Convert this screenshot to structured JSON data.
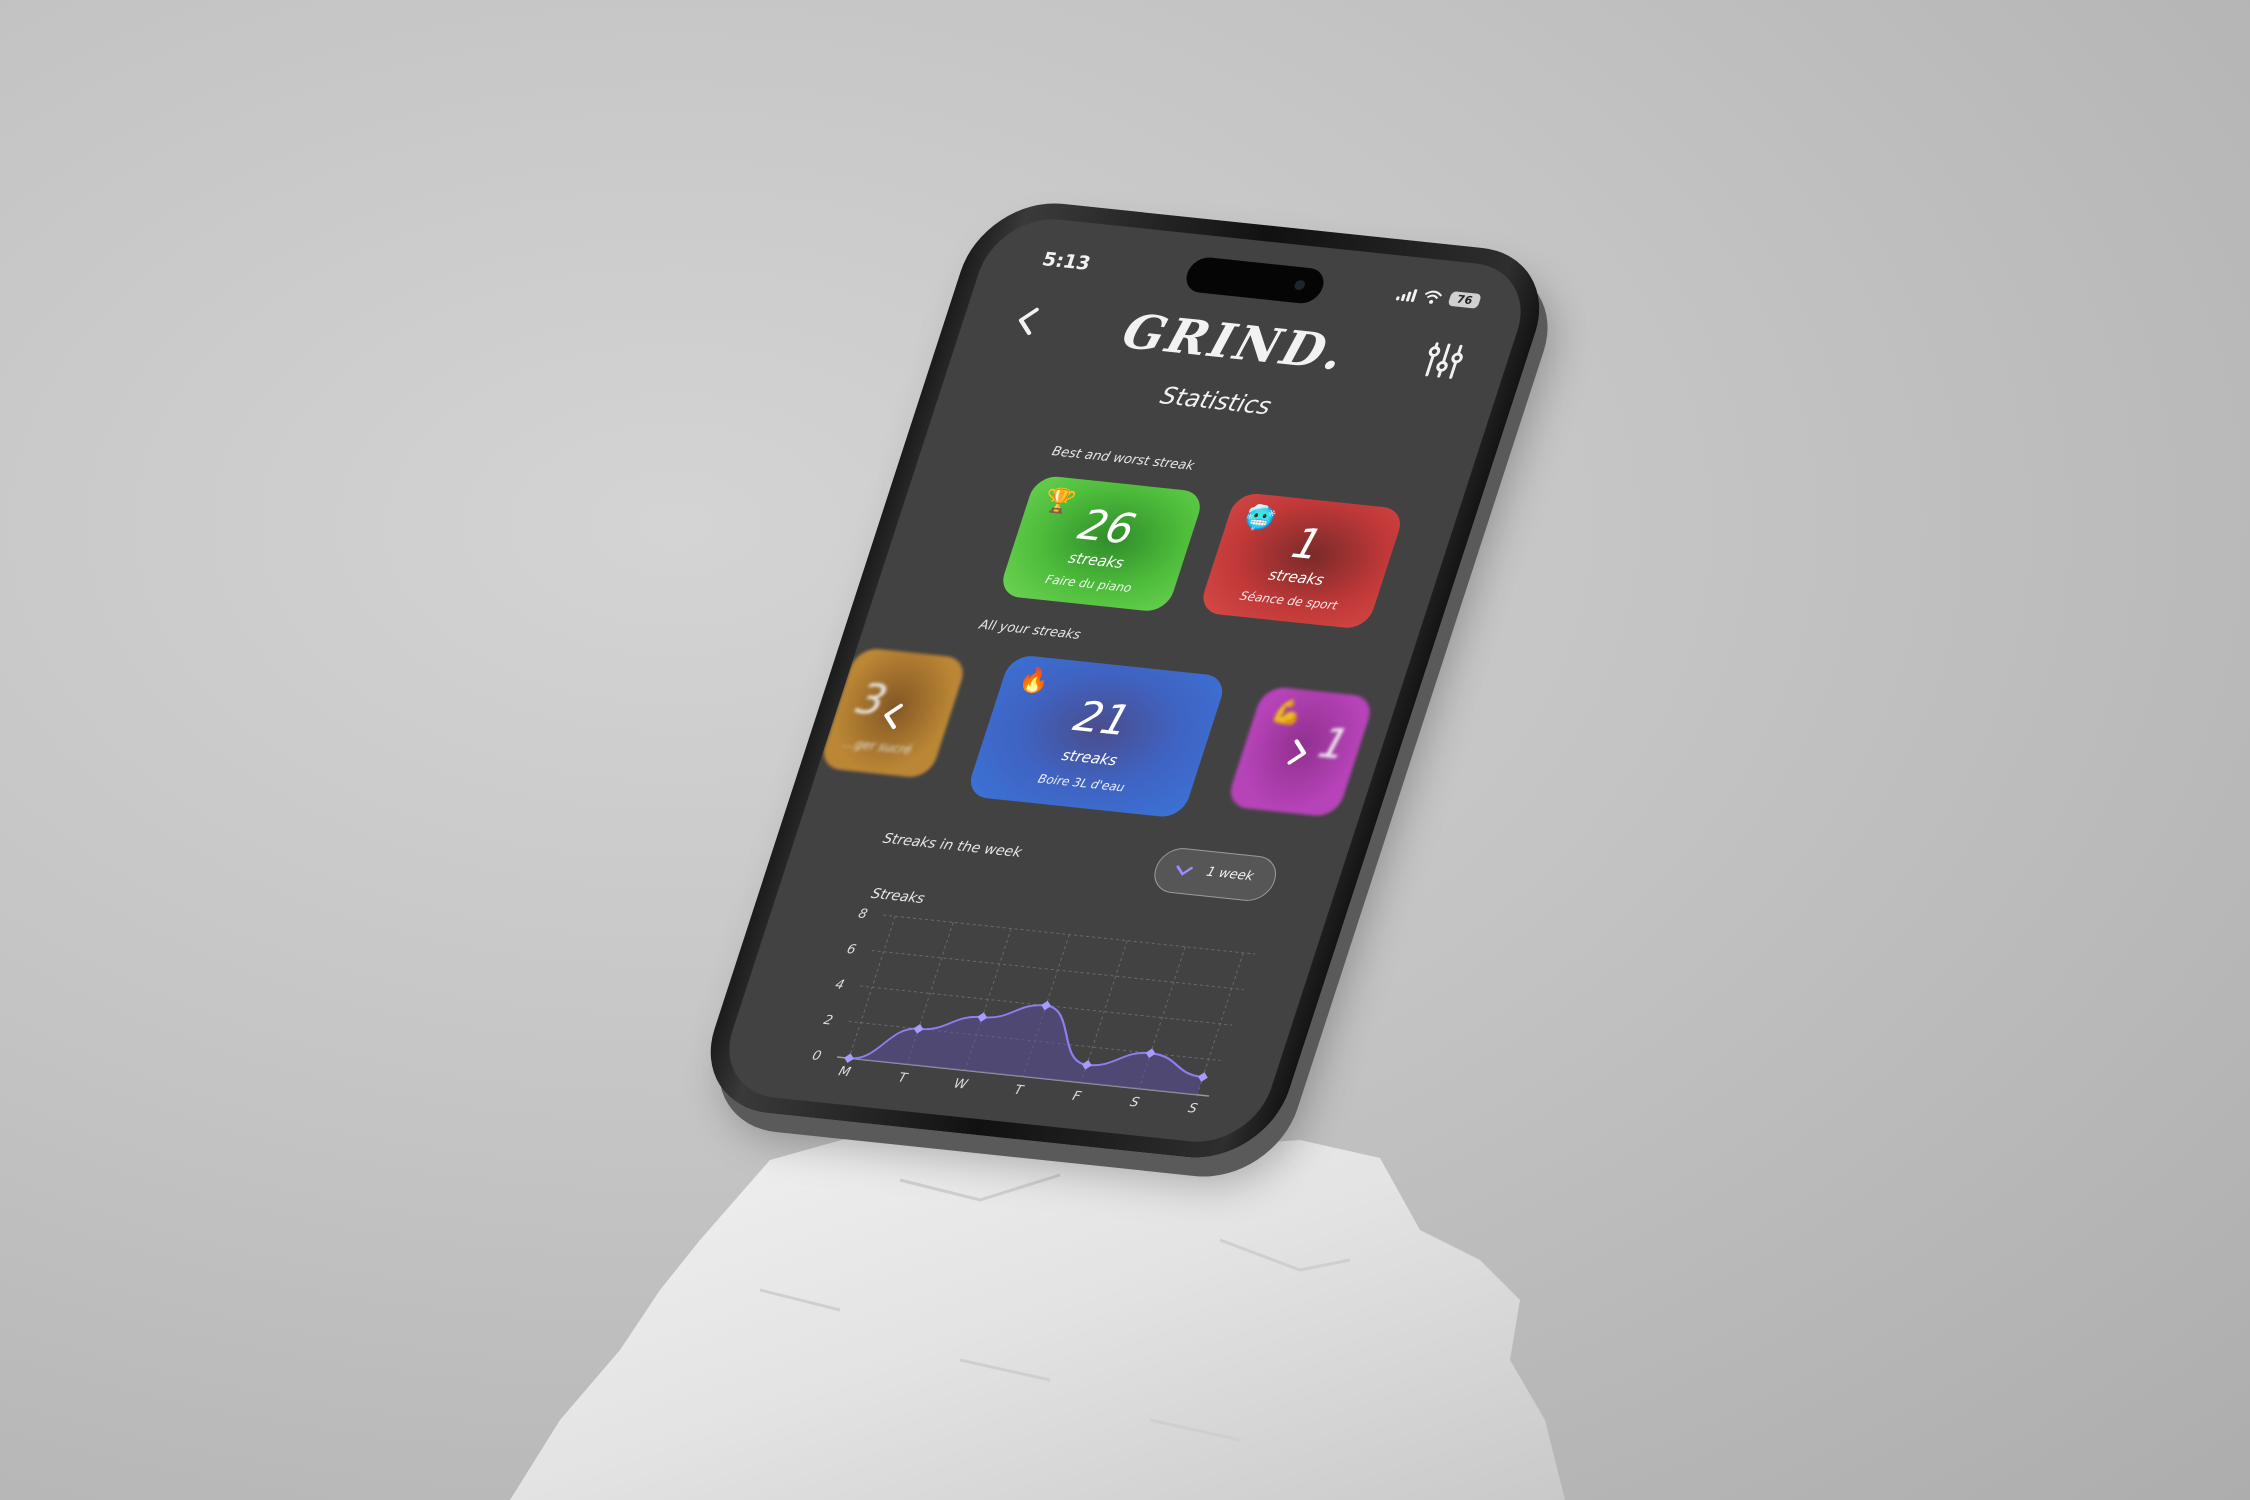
{
  "status_bar": {
    "time": "5:13",
    "battery": "76"
  },
  "header": {
    "logo": "GRIND."
  },
  "page_title": "Statistics",
  "best_worst": {
    "label": "Best and worst streak",
    "best": {
      "emoji": "🏆",
      "count": "26",
      "unit": "streaks",
      "name": "Faire du piano",
      "color": "#4fbe3c"
    },
    "worst": {
      "emoji": "🥶",
      "count": "1",
      "unit": "streaks",
      "name": "Séance de sport",
      "color": "#c03838"
    }
  },
  "all_streaks": {
    "label": "All your streaks",
    "items": [
      {
        "emoji": "",
        "count": "3",
        "unit": "",
        "name": "…ger sucré",
        "color": "#c98f34"
      },
      {
        "emoji": "🔥",
        "count": "21",
        "unit": "streaks",
        "name": "Boire 3L d'eau",
        "color": "#3f63c2"
      },
      {
        "emoji": "💪",
        "count": "1",
        "unit": "",
        "name": "",
        "color": "#c444c6"
      }
    ]
  },
  "week_section": {
    "label": "Streaks in the week",
    "period_button": "1 week"
  },
  "chart_data": {
    "type": "area",
    "ylabel": "Streaks",
    "categories": [
      "M",
      "T",
      "W",
      "T",
      "F",
      "S",
      "S"
    ],
    "values": [
      0,
      2,
      3,
      4,
      1,
      2,
      1
    ],
    "ylim": [
      0,
      8
    ],
    "yticks": [
      "0",
      "2",
      "4",
      "6",
      "8"
    ],
    "grid": true,
    "color": "#7b6fd6"
  }
}
